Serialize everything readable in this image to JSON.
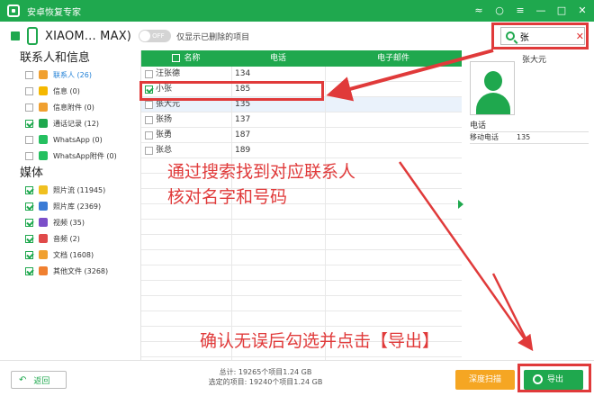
{
  "app": {
    "title": "安卓恢复专家"
  },
  "device": {
    "name": "XIAOM... MAX)",
    "toggle_state": "OFF",
    "toggle_label": "仅显示已删除的项目"
  },
  "search": {
    "value": "张"
  },
  "sidebar": {
    "section_contacts": "联系人和信息",
    "contacts_items": [
      {
        "label": "联系人 (26)",
        "icon": "contact-icon",
        "color": "#f0a030",
        "checked": false
      },
      {
        "label": "信息 (0)",
        "icon": "message-icon",
        "color": "#f5b800",
        "checked": false
      },
      {
        "label": "信息附件 (0)",
        "icon": "attachment-icon",
        "color": "#f0a030",
        "checked": false
      },
      {
        "label": "通话记录 (12)",
        "icon": "call-log-icon",
        "color": "#1fa84e",
        "checked": true
      },
      {
        "label": "WhatsApp (0)",
        "icon": "whatsapp-icon",
        "color": "#25c060",
        "checked": false
      },
      {
        "label": "WhatsApp附件 (0)",
        "icon": "whatsapp-attachment-icon",
        "color": "#25c060",
        "checked": false
      }
    ],
    "section_media": "媒体",
    "media_items": [
      {
        "label": "照片流 (11945)",
        "icon": "photo-stream-icon",
        "color": "#f0c020",
        "checked": true
      },
      {
        "label": "照片库 (2369)",
        "icon": "photo-library-icon",
        "color": "#3a7bd5",
        "checked": true
      },
      {
        "label": "视频 (35)",
        "icon": "video-icon",
        "color": "#7b4fc9",
        "checked": true
      },
      {
        "label": "音频 (2)",
        "icon": "audio-icon",
        "color": "#e04a4a",
        "checked": true
      },
      {
        "label": "文档 (1608)",
        "icon": "document-icon",
        "color": "#f0a030",
        "checked": true
      },
      {
        "label": "其他文件 (3268)",
        "icon": "other-files-icon",
        "color": "#f08030",
        "checked": true
      }
    ]
  },
  "table": {
    "headers": {
      "name": "名称",
      "phone": "电话",
      "email": "电子邮件"
    },
    "rows": [
      {
        "name": "汪张德",
        "phone": "134",
        "checked": false
      },
      {
        "name": "小张",
        "phone": "185",
        "checked": true
      },
      {
        "name": "张大元",
        "phone": "135",
        "checked": false
      },
      {
        "name": "张扬",
        "phone": "137",
        "checked": false
      },
      {
        "name": "张勇",
        "phone": "187",
        "checked": false
      },
      {
        "name": "张总",
        "phone": "189",
        "checked": false
      }
    ]
  },
  "detail": {
    "name": "张大元",
    "phone_title": "电话",
    "phone_label": "移动电话",
    "phone_value": "135"
  },
  "footer": {
    "back": "返回",
    "total": "总计: 19265个项目1.24 GB",
    "selected": "选定的项目: 19240个项目1.24 GB",
    "deep_scan": "深度扫描",
    "export": "导出"
  },
  "annotations": {
    "line1": "通过搜索找到对应联系人",
    "line2": "核对名字和号码",
    "line3": "确认无误后勾选并点击【导出】",
    "color": "#e03a3a"
  },
  "colors": {
    "brand": "#1fa84e",
    "accent": "#f5a623"
  }
}
